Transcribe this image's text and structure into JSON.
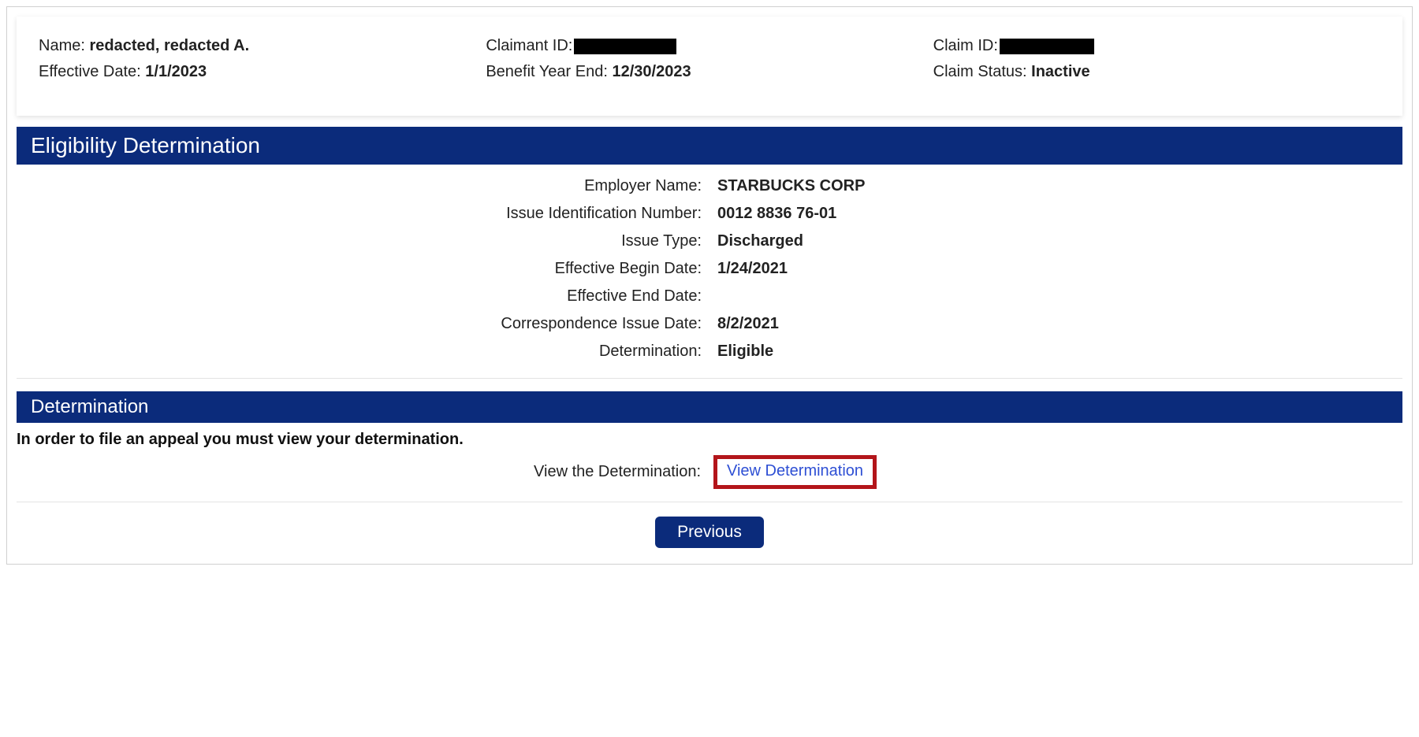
{
  "summary": {
    "name_label": "Name: ",
    "name_value": "redacted, redacted A.",
    "effective_date_label": "Effective Date: ",
    "effective_date_value": "1/1/2023",
    "claimant_id_label": "Claimant ID:",
    "benefit_year_end_label": "Benefit Year End: ",
    "benefit_year_end_value": "12/30/2023",
    "claim_id_label": "Claim ID:",
    "claim_status_label": "Claim Status: ",
    "claim_status_value": "Inactive"
  },
  "section_eligibility_title": "Eligibility Determination",
  "details": {
    "employer_name_label": "Employer Name:",
    "employer_name_value": "STARBUCKS CORP",
    "issue_id_label": "Issue Identification Number:",
    "issue_id_value": "0012 8836 76-01",
    "issue_type_label": "Issue Type:",
    "issue_type_value": "Discharged",
    "eff_begin_label": "Effective Begin Date:",
    "eff_begin_value": "1/24/2021",
    "eff_end_label": "Effective End Date:",
    "eff_end_value": "",
    "corr_issue_label": "Correspondence Issue Date:",
    "corr_issue_value": "8/2/2021",
    "determination_label": "Determination:",
    "determination_value": "Eligible"
  },
  "section_determination_title": "Determination",
  "appeal_notice": "In order to file an appeal you must view your determination.",
  "view_determination_label": "View the Determination:",
  "view_determination_link": "View Determination",
  "previous_button": "Previous"
}
